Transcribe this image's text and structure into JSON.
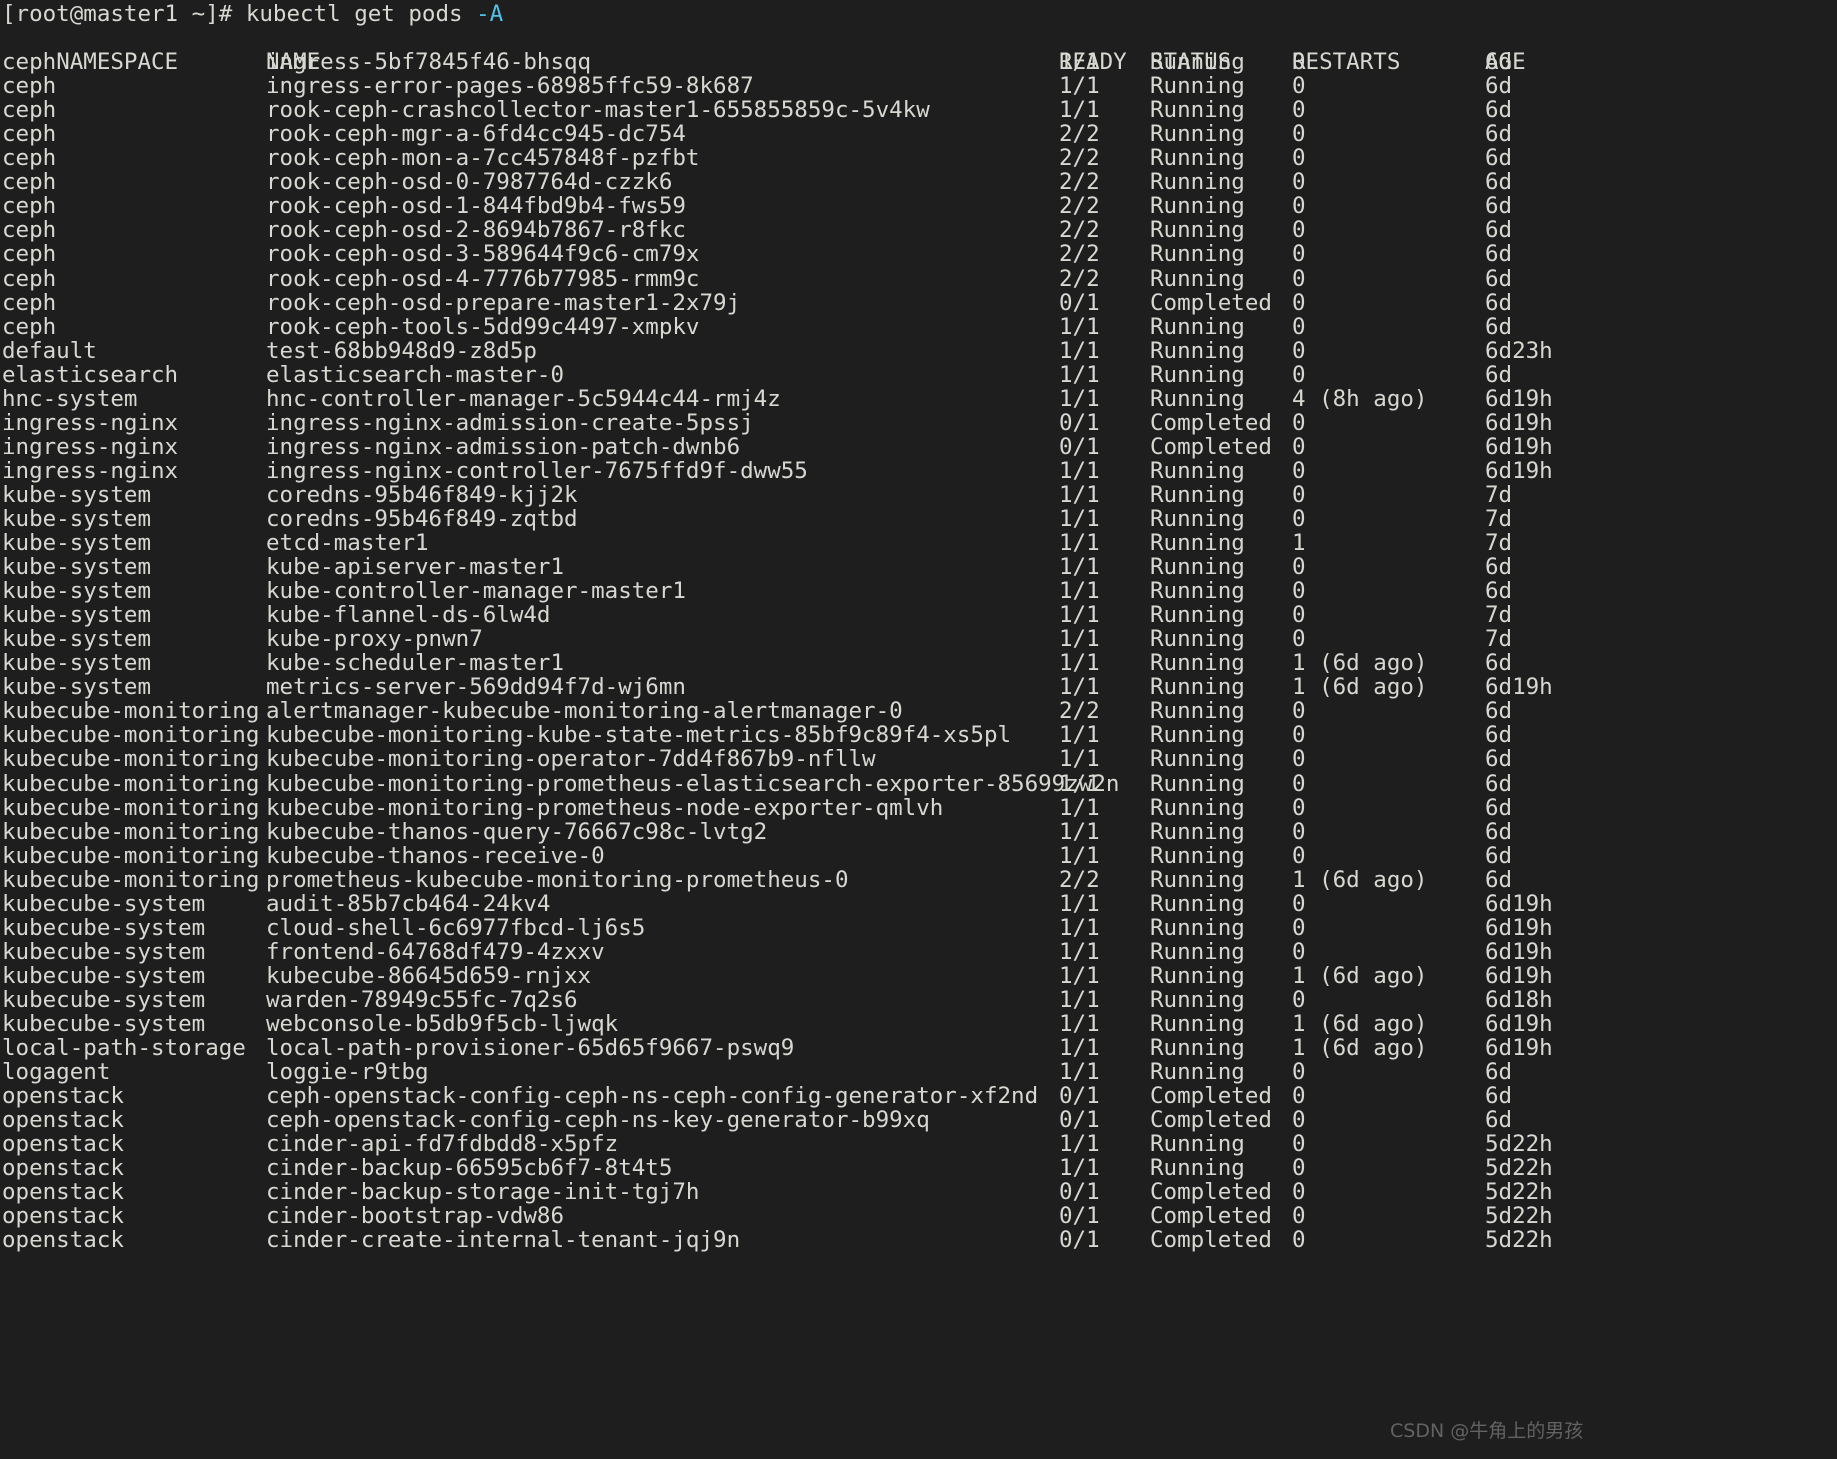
{
  "terminal": {
    "prompt": "[root@master1 ~]# kubectl get pods ",
    "command_flag": "-A",
    "colors": {
      "background": "#1e1e1e",
      "foreground": "#d8d8d2",
      "flag_accent": "#4fc1e9",
      "watermark": "#6e6e6e"
    },
    "watermark": "CSDN @牛角上的男孩"
  },
  "table": {
    "headers": {
      "namespace": "NAMESPACE",
      "name": "NAME",
      "ready": "READY",
      "status": "STATUS",
      "restarts": "RESTARTS",
      "age": "AGE"
    },
    "rows": [
      {
        "namespace": "ceph",
        "name": "ingress-5bf7845f46-bhsqq",
        "ready": "1/1",
        "status": "Running",
        "restarts": "0",
        "age": "6d"
      },
      {
        "namespace": "ceph",
        "name": "ingress-error-pages-68985ffc59-8k687",
        "ready": "1/1",
        "status": "Running",
        "restarts": "0",
        "age": "6d"
      },
      {
        "namespace": "ceph",
        "name": "rook-ceph-crashcollector-master1-655855859c-5v4kw",
        "ready": "1/1",
        "status": "Running",
        "restarts": "0",
        "age": "6d"
      },
      {
        "namespace": "ceph",
        "name": "rook-ceph-mgr-a-6fd4cc945-dc754",
        "ready": "2/2",
        "status": "Running",
        "restarts": "0",
        "age": "6d"
      },
      {
        "namespace": "ceph",
        "name": "rook-ceph-mon-a-7cc457848f-pzfbt",
        "ready": "2/2",
        "status": "Running",
        "restarts": "0",
        "age": "6d"
      },
      {
        "namespace": "ceph",
        "name": "rook-ceph-osd-0-7987764d-czzk6",
        "ready": "2/2",
        "status": "Running",
        "restarts": "0",
        "age": "6d"
      },
      {
        "namespace": "ceph",
        "name": "rook-ceph-osd-1-844fbd9b4-fws59",
        "ready": "2/2",
        "status": "Running",
        "restarts": "0",
        "age": "6d"
      },
      {
        "namespace": "ceph",
        "name": "rook-ceph-osd-2-8694b7867-r8fkc",
        "ready": "2/2",
        "status": "Running",
        "restarts": "0",
        "age": "6d"
      },
      {
        "namespace": "ceph",
        "name": "rook-ceph-osd-3-589644f9c6-cm79x",
        "ready": "2/2",
        "status": "Running",
        "restarts": "0",
        "age": "6d"
      },
      {
        "namespace": "ceph",
        "name": "rook-ceph-osd-4-7776b77985-rmm9c",
        "ready": "2/2",
        "status": "Running",
        "restarts": "0",
        "age": "6d"
      },
      {
        "namespace": "ceph",
        "name": "rook-ceph-osd-prepare-master1-2x79j",
        "ready": "0/1",
        "status": "Completed",
        "restarts": "0",
        "age": "6d"
      },
      {
        "namespace": "ceph",
        "name": "rook-ceph-tools-5dd99c4497-xmpkv",
        "ready": "1/1",
        "status": "Running",
        "restarts": "0",
        "age": "6d"
      },
      {
        "namespace": "default",
        "name": "test-68bb948d9-z8d5p",
        "ready": "1/1",
        "status": "Running",
        "restarts": "0",
        "age": "6d23h"
      },
      {
        "namespace": "elasticsearch",
        "name": "elasticsearch-master-0",
        "ready": "1/1",
        "status": "Running",
        "restarts": "0",
        "age": "6d"
      },
      {
        "namespace": "hnc-system",
        "name": "hnc-controller-manager-5c5944c44-rmj4z",
        "ready": "1/1",
        "status": "Running",
        "restarts": "4 (8h ago)",
        "age": "6d19h"
      },
      {
        "namespace": "ingress-nginx",
        "name": "ingress-nginx-admission-create-5pssj",
        "ready": "0/1",
        "status": "Completed",
        "restarts": "0",
        "age": "6d19h"
      },
      {
        "namespace": "ingress-nginx",
        "name": "ingress-nginx-admission-patch-dwnb6",
        "ready": "0/1",
        "status": "Completed",
        "restarts": "0",
        "age": "6d19h"
      },
      {
        "namespace": "ingress-nginx",
        "name": "ingress-nginx-controller-7675ffd9f-dww55",
        "ready": "1/1",
        "status": "Running",
        "restarts": "0",
        "age": "6d19h"
      },
      {
        "namespace": "kube-system",
        "name": "coredns-95b46f849-kjj2k",
        "ready": "1/1",
        "status": "Running",
        "restarts": "0",
        "age": "7d"
      },
      {
        "namespace": "kube-system",
        "name": "coredns-95b46f849-zqtbd",
        "ready": "1/1",
        "status": "Running",
        "restarts": "0",
        "age": "7d"
      },
      {
        "namespace": "kube-system",
        "name": "etcd-master1",
        "ready": "1/1",
        "status": "Running",
        "restarts": "1",
        "age": "7d"
      },
      {
        "namespace": "kube-system",
        "name": "kube-apiserver-master1",
        "ready": "1/1",
        "status": "Running",
        "restarts": "0",
        "age": "6d"
      },
      {
        "namespace": "kube-system",
        "name": "kube-controller-manager-master1",
        "ready": "1/1",
        "status": "Running",
        "restarts": "0",
        "age": "6d"
      },
      {
        "namespace": "kube-system",
        "name": "kube-flannel-ds-6lw4d",
        "ready": "1/1",
        "status": "Running",
        "restarts": "0",
        "age": "7d"
      },
      {
        "namespace": "kube-system",
        "name": "kube-proxy-pnwn7",
        "ready": "1/1",
        "status": "Running",
        "restarts": "0",
        "age": "7d"
      },
      {
        "namespace": "kube-system",
        "name": "kube-scheduler-master1",
        "ready": "1/1",
        "status": "Running",
        "restarts": "1 (6d ago)",
        "age": "6d"
      },
      {
        "namespace": "kube-system",
        "name": "metrics-server-569dd94f7d-wj6mn",
        "ready": "1/1",
        "status": "Running",
        "restarts": "1 (6d ago)",
        "age": "6d19h"
      },
      {
        "namespace": "kubecube-monitoring",
        "name": "alertmanager-kubecube-monitoring-alertmanager-0",
        "ready": "2/2",
        "status": "Running",
        "restarts": "0",
        "age": "6d"
      },
      {
        "namespace": "kubecube-monitoring",
        "name": "kubecube-monitoring-kube-state-metrics-85bf9c89f4-xs5pl",
        "ready": "1/1",
        "status": "Running",
        "restarts": "0",
        "age": "6d"
      },
      {
        "namespace": "kubecube-monitoring",
        "name": "kubecube-monitoring-operator-7dd4f867b9-nfllw",
        "ready": "1/1",
        "status": "Running",
        "restarts": "0",
        "age": "6d"
      },
      {
        "namespace": "kubecube-monitoring",
        "name": "kubecube-monitoring-prometheus-elasticsearch-exporter-85699zw2n",
        "ready": "1/1",
        "status": "Running",
        "restarts": "0",
        "age": "6d"
      },
      {
        "namespace": "kubecube-monitoring",
        "name": "kubecube-monitoring-prometheus-node-exporter-qmlvh",
        "ready": "1/1",
        "status": "Running",
        "restarts": "0",
        "age": "6d"
      },
      {
        "namespace": "kubecube-monitoring",
        "name": "kubecube-thanos-query-76667c98c-lvtg2",
        "ready": "1/1",
        "status": "Running",
        "restarts": "0",
        "age": "6d"
      },
      {
        "namespace": "kubecube-monitoring",
        "name": "kubecube-thanos-receive-0",
        "ready": "1/1",
        "status": "Running",
        "restarts": "0",
        "age": "6d"
      },
      {
        "namespace": "kubecube-monitoring",
        "name": "prometheus-kubecube-monitoring-prometheus-0",
        "ready": "2/2",
        "status": "Running",
        "restarts": "1 (6d ago)",
        "age": "6d"
      },
      {
        "namespace": "kubecube-system",
        "name": "audit-85b7cb464-24kv4",
        "ready": "1/1",
        "status": "Running",
        "restarts": "0",
        "age": "6d19h"
      },
      {
        "namespace": "kubecube-system",
        "name": "cloud-shell-6c6977fbcd-lj6s5",
        "ready": "1/1",
        "status": "Running",
        "restarts": "0",
        "age": "6d19h"
      },
      {
        "namespace": "kubecube-system",
        "name": "frontend-64768df479-4zxxv",
        "ready": "1/1",
        "status": "Running",
        "restarts": "0",
        "age": "6d19h"
      },
      {
        "namespace": "kubecube-system",
        "name": "kubecube-86645d659-rnjxx",
        "ready": "1/1",
        "status": "Running",
        "restarts": "1 (6d ago)",
        "age": "6d19h"
      },
      {
        "namespace": "kubecube-system",
        "name": "warden-78949c55fc-7q2s6",
        "ready": "1/1",
        "status": "Running",
        "restarts": "0",
        "age": "6d18h"
      },
      {
        "namespace": "kubecube-system",
        "name": "webconsole-b5db9f5cb-ljwqk",
        "ready": "1/1",
        "status": "Running",
        "restarts": "1 (6d ago)",
        "age": "6d19h"
      },
      {
        "namespace": "local-path-storage",
        "name": "local-path-provisioner-65d65f9667-pswq9",
        "ready": "1/1",
        "status": "Running",
        "restarts": "1 (6d ago)",
        "age": "6d19h"
      },
      {
        "namespace": "logagent",
        "name": "loggie-r9tbg",
        "ready": "1/1",
        "status": "Running",
        "restarts": "0",
        "age": "6d"
      },
      {
        "namespace": "openstack",
        "name": "ceph-openstack-config-ceph-ns-ceph-config-generator-xf2nd",
        "ready": "0/1",
        "status": "Completed",
        "restarts": "0",
        "age": "6d"
      },
      {
        "namespace": "openstack",
        "name": "ceph-openstack-config-ceph-ns-key-generator-b99xq",
        "ready": "0/1",
        "status": "Completed",
        "restarts": "0",
        "age": "6d"
      },
      {
        "namespace": "openstack",
        "name": "cinder-api-fd7fdbdd8-x5pfz",
        "ready": "1/1",
        "status": "Running",
        "restarts": "0",
        "age": "5d22h"
      },
      {
        "namespace": "openstack",
        "name": "cinder-backup-66595cb6f7-8t4t5",
        "ready": "1/1",
        "status": "Running",
        "restarts": "0",
        "age": "5d22h"
      },
      {
        "namespace": "openstack",
        "name": "cinder-backup-storage-init-tgj7h",
        "ready": "0/1",
        "status": "Completed",
        "restarts": "0",
        "age": "5d22h"
      },
      {
        "namespace": "openstack",
        "name": "cinder-bootstrap-vdw86",
        "ready": "0/1",
        "status": "Completed",
        "restarts": "0",
        "age": "5d22h"
      },
      {
        "namespace": "openstack",
        "name": "cinder-create-internal-tenant-jqj9n",
        "ready": "0/1",
        "status": "Completed",
        "restarts": "0",
        "age": "5d22h"
      }
    ]
  }
}
